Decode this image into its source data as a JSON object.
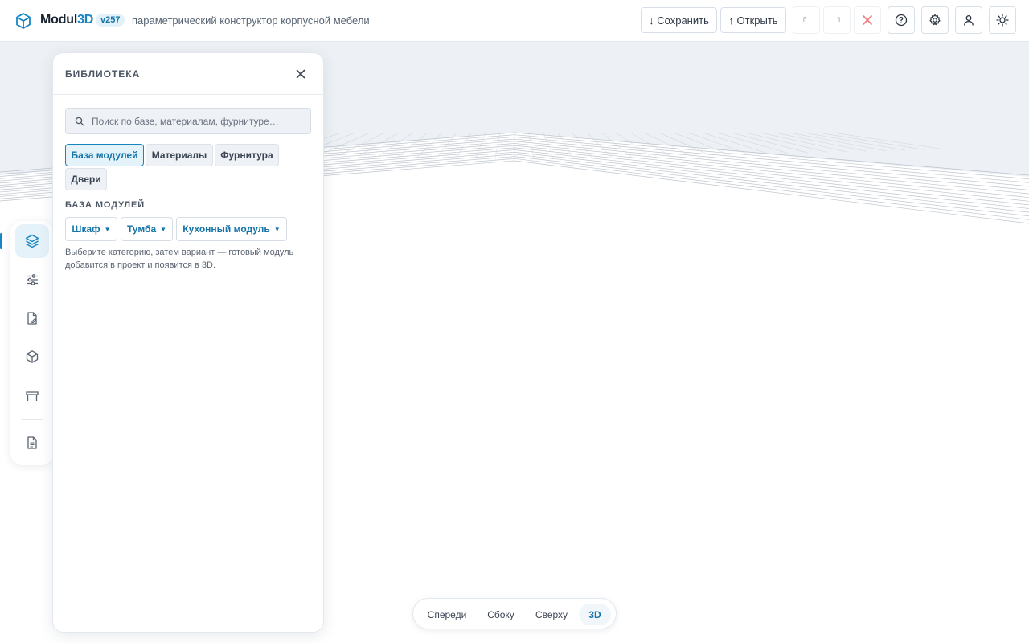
{
  "header": {
    "brand_main": "Modul",
    "brand_accent": "3D",
    "version": "v257",
    "subtitle": "параметрический конструктор корпусной мебели",
    "save_label": "↓ Сохранить",
    "open_label": "↑ Открыть",
    "icons": [
      "cube-logo-icon",
      "undo-icon",
      "redo-icon",
      "clear-icon",
      "help-icon",
      "gear-icon",
      "user-icon",
      "sun-icon"
    ]
  },
  "sidebar": {
    "items": [
      {
        "name": "layers-icon",
        "active": true
      },
      {
        "name": "sliders-icon",
        "active": false
      },
      {
        "name": "file-edit-icon",
        "active": false
      },
      {
        "name": "box-icon",
        "active": false
      },
      {
        "name": "table-icon",
        "active": false
      },
      {
        "name": "document-icon",
        "active": false
      }
    ]
  },
  "library": {
    "title": "БИБЛИОТЕКА",
    "search_placeholder": "Поиск по базе, материалам, фурнитуре…",
    "tabs": [
      {
        "label": "База модулей",
        "active": true
      },
      {
        "label": "Материалы",
        "active": false
      },
      {
        "label": "Фурнитура",
        "active": false
      },
      {
        "label": "Двери",
        "active": false
      }
    ],
    "section_title": "БАЗА МОДУЛЕЙ",
    "categories": [
      {
        "label": "Шкаф"
      },
      {
        "label": "Тумба"
      },
      {
        "label": "Кухонный модуль"
      }
    ],
    "hint": "Выберите категорию, затем вариант — готовый модуль добавится в проект и появится в 3D."
  },
  "views": {
    "items": [
      {
        "label": "Спереди",
        "active": false
      },
      {
        "label": "Сбоку",
        "active": false
      },
      {
        "label": "Сверху",
        "active": false
      },
      {
        "label": "3D",
        "active": true
      }
    ]
  },
  "colors": {
    "accent": "#1785c2",
    "danger": "#e0484f",
    "sky": "#edf1f5"
  }
}
